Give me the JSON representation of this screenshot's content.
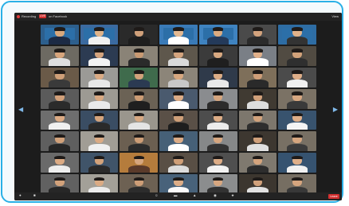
{
  "topbar": {
    "recording_label": "Recording",
    "live_badge": "LIVE",
    "live_status": "on Facebook",
    "view_label": "View"
  },
  "nav": {
    "prev_icon": "chevron-left-icon",
    "next_icon": "chevron-right-icon"
  },
  "participants": [
    {
      "name": "",
      "bg": "#2d5f8d",
      "shirt": "#1c2a44",
      "skin": "#d9a87c",
      "banner": true
    },
    {
      "name": "",
      "bg": "#3b6aa0",
      "shirt": "#f0f0f0",
      "skin": "#e0b48a",
      "banner": true
    },
    {
      "name": "",
      "bg": "#2a2a2a",
      "shirt": "#1e1e1e",
      "skin": "#cfa07a",
      "banner": false
    },
    {
      "name": "",
      "bg": "#3a7bb8",
      "shirt": "#ffffff",
      "skin": "#e3b992",
      "banner": true
    },
    {
      "name": "",
      "bg": "#3f83c0",
      "shirt": "#243a5a",
      "skin": "#dcab80",
      "banner": true
    },
    {
      "name": "",
      "bg": "#4a4a4a",
      "shirt": "#2b2b2b",
      "skin": "#d3a37d",
      "banner": false
    },
    {
      "name": "",
      "bg": "#2e6da4",
      "shirt": "#333333",
      "skin": "#e1b28a",
      "banner": true
    },
    {
      "name": "",
      "bg": "#6d6a62",
      "shirt": "#dedede",
      "skin": "#d7a57c",
      "banner": false
    },
    {
      "name": "",
      "bg": "#2c3b52",
      "shirt": "#f2f2f2",
      "skin": "#d4a47e",
      "banner": false
    },
    {
      "name": "",
      "bg": "#8a8377",
      "shirt": "#2a2a2a",
      "skin": "#c99a73",
      "banner": false
    },
    {
      "name": "",
      "bg": "#5e574c",
      "shirt": "#dadada",
      "skin": "#d4a47e",
      "banner": false
    },
    {
      "name": "",
      "bg": "#3b3b3b",
      "shirt": "#1f1f1f",
      "skin": "#d8a981",
      "banner": false
    },
    {
      "name": "",
      "bg": "#7a7f86",
      "shirt": "#ffffff",
      "skin": "#e0b08a",
      "banner": false
    },
    {
      "name": "",
      "bg": "#514b42",
      "shirt": "#2f2f2f",
      "skin": "#d2a27a",
      "banner": false
    },
    {
      "name": "",
      "bg": "#6a5a48",
      "shirt": "#3a3a3a",
      "skin": "#cf9f78",
      "banner": false
    },
    {
      "name": "",
      "bg": "#9b9a96",
      "shirt": "#e8e8e8",
      "skin": "#dbab84",
      "banner": false
    },
    {
      "name": "",
      "bg": "#3f6b4c",
      "shirt": "#2b3a52",
      "skin": "#d2a27b",
      "banner": false
    },
    {
      "name": "",
      "bg": "#8c8579",
      "shirt": "#c8c8c8",
      "skin": "#d8a880",
      "banner": false
    },
    {
      "name": "",
      "bg": "#2f3a4a",
      "shirt": "#e9e9e9",
      "skin": "#dcad86",
      "banner": false
    },
    {
      "name": "",
      "bg": "#7e6f5a",
      "shirt": "#2a2a2a",
      "skin": "#cf9e78",
      "banner": false
    },
    {
      "name": "",
      "bg": "#4b4b4b",
      "shirt": "#f0f0f0",
      "skin": "#dfae88",
      "banner": false
    },
    {
      "name": "",
      "bg": "#5b5b5b",
      "shirt": "#2b2b2b",
      "skin": "#d1a07a",
      "banner": false
    },
    {
      "name": "",
      "bg": "#9d9a93",
      "shirt": "#eaeaea",
      "skin": "#d9a982",
      "banner": false
    },
    {
      "name": "",
      "bg": "#6b6255",
      "shirt": "#1f1f1f",
      "skin": "#cc9c74",
      "banner": false
    },
    {
      "name": "",
      "bg": "#4a5a6e",
      "shirt": "#ffffff",
      "skin": "#dcac86",
      "banner": false
    },
    {
      "name": "",
      "bg": "#8a8c8f",
      "shirt": "#2c2c2c",
      "skin": "#d5a57e",
      "banner": false
    },
    {
      "name": "",
      "bg": "#403a32",
      "shirt": "#dddddd",
      "skin": "#d0a07a",
      "banner": false
    },
    {
      "name": "",
      "bg": "#7b7265",
      "shirt": "#3a3a3a",
      "skin": "#d7a780",
      "banner": false
    },
    {
      "name": "",
      "bg": "#6e6e6e",
      "shirt": "#f0f0f0",
      "skin": "#dcab84",
      "banner": false
    },
    {
      "name": "",
      "bg": "#3a4d63",
      "shirt": "#2a2a2a",
      "skin": "#d4a47c",
      "banner": false
    },
    {
      "name": "",
      "bg": "#9a968d",
      "shirt": "#e4e4e4",
      "skin": "#d8a982",
      "banner": false
    },
    {
      "name": "",
      "bg": "#5a5047",
      "shirt": "#1e1e1e",
      "skin": "#cf9f78",
      "banner": false
    },
    {
      "name": "",
      "bg": "#4d4d4d",
      "shirt": "#ececec",
      "skin": "#ddad86",
      "banner": false
    },
    {
      "name": "",
      "bg": "#7d776d",
      "shirt": "#2e2e2e",
      "skin": "#d3a37c",
      "banner": false
    },
    {
      "name": "",
      "bg": "#38536e",
      "shirt": "#f4f4f4",
      "skin": "#deae88",
      "banner": false
    },
    {
      "name": "",
      "bg": "#5f5f5f",
      "shirt": "#262626",
      "skin": "#d1a17a",
      "banner": false
    },
    {
      "name": "",
      "bg": "#a19d95",
      "shirt": "#f0f0f0",
      "skin": "#dbab84",
      "banner": false
    },
    {
      "name": "",
      "bg": "#6b5f51",
      "shirt": "#2b2b2b",
      "skin": "#cd9d76",
      "banner": false
    },
    {
      "name": "",
      "bg": "#466077",
      "shirt": "#ffffff",
      "skin": "#dcac86",
      "banner": false
    },
    {
      "name": "",
      "bg": "#868889",
      "shirt": "#333333",
      "skin": "#d6a67f",
      "banner": false
    },
    {
      "name": "",
      "bg": "#3d3730",
      "shirt": "#e0e0e0",
      "skin": "#d0a07a",
      "banner": false
    },
    {
      "name": "",
      "bg": "#787064",
      "shirt": "#3b3b3b",
      "skin": "#d6a67f",
      "banner": false
    },
    {
      "name": "",
      "bg": "#6a6a6a",
      "shirt": "#eeeeee",
      "skin": "#dcab84",
      "banner": false
    },
    {
      "name": "",
      "bg": "#405469",
      "shirt": "#2a2a2a",
      "skin": "#d3a37b",
      "banner": false
    },
    {
      "name": "",
      "bg": "#b57c3c",
      "shirt": "#5a3a2a",
      "skin": "#d6a67e",
      "banner": false
    },
    {
      "name": "",
      "bg": "#594f45",
      "shirt": "#dcdcdc",
      "skin": "#cf9f78",
      "banner": false
    },
    {
      "name": "",
      "bg": "#4f4f4f",
      "shirt": "#f2f2f2",
      "skin": "#ddad87",
      "banner": false
    },
    {
      "name": "",
      "bg": "#7f796f",
      "shirt": "#2d2d2d",
      "skin": "#d4a47d",
      "banner": false
    },
    {
      "name": "",
      "bg": "#365370",
      "shirt": "#f1f1f1",
      "skin": "#dfaf89",
      "banner": false
    },
    {
      "name": "",
      "bg": "#616161",
      "shirt": "#272727",
      "skin": "#d2a27b",
      "banner": false
    },
    {
      "name": "",
      "bg": "#a3a098",
      "shirt": "#ececec",
      "skin": "#dbab84",
      "banner": false
    },
    {
      "name": "",
      "bg": "#6d6153",
      "shirt": "#2c2c2c",
      "skin": "#ce9e77",
      "banner": false
    },
    {
      "name": "",
      "bg": "#48627a",
      "shirt": "#fafafa",
      "skin": "#ddad87",
      "banner": false
    },
    {
      "name": "",
      "bg": "#8b8d8e",
      "shirt": "#323232",
      "skin": "#d7a780",
      "banner": false
    },
    {
      "name": "",
      "bg": "#3c362f",
      "shirt": "#e2e2e2",
      "skin": "#d1a17b",
      "banner": false
    },
    {
      "name": "",
      "bg": "#766e62",
      "shirt": "#383838",
      "skin": "#d5a57e",
      "banner": false
    }
  ],
  "toolbar": [
    {
      "label": "Unmute",
      "icon": "mic-icon"
    },
    {
      "label": "Start Video",
      "icon": "camera-icon"
    },
    {
      "label": "Participants",
      "icon": "participants-icon"
    },
    {
      "label": "Chat",
      "icon": "chat-icon"
    },
    {
      "label": "Share Screen",
      "icon": "share-screen-icon"
    },
    {
      "label": "Record",
      "icon": "record-icon"
    },
    {
      "label": "Reactions",
      "icon": "reactions-icon"
    }
  ],
  "end_label": "Leave"
}
